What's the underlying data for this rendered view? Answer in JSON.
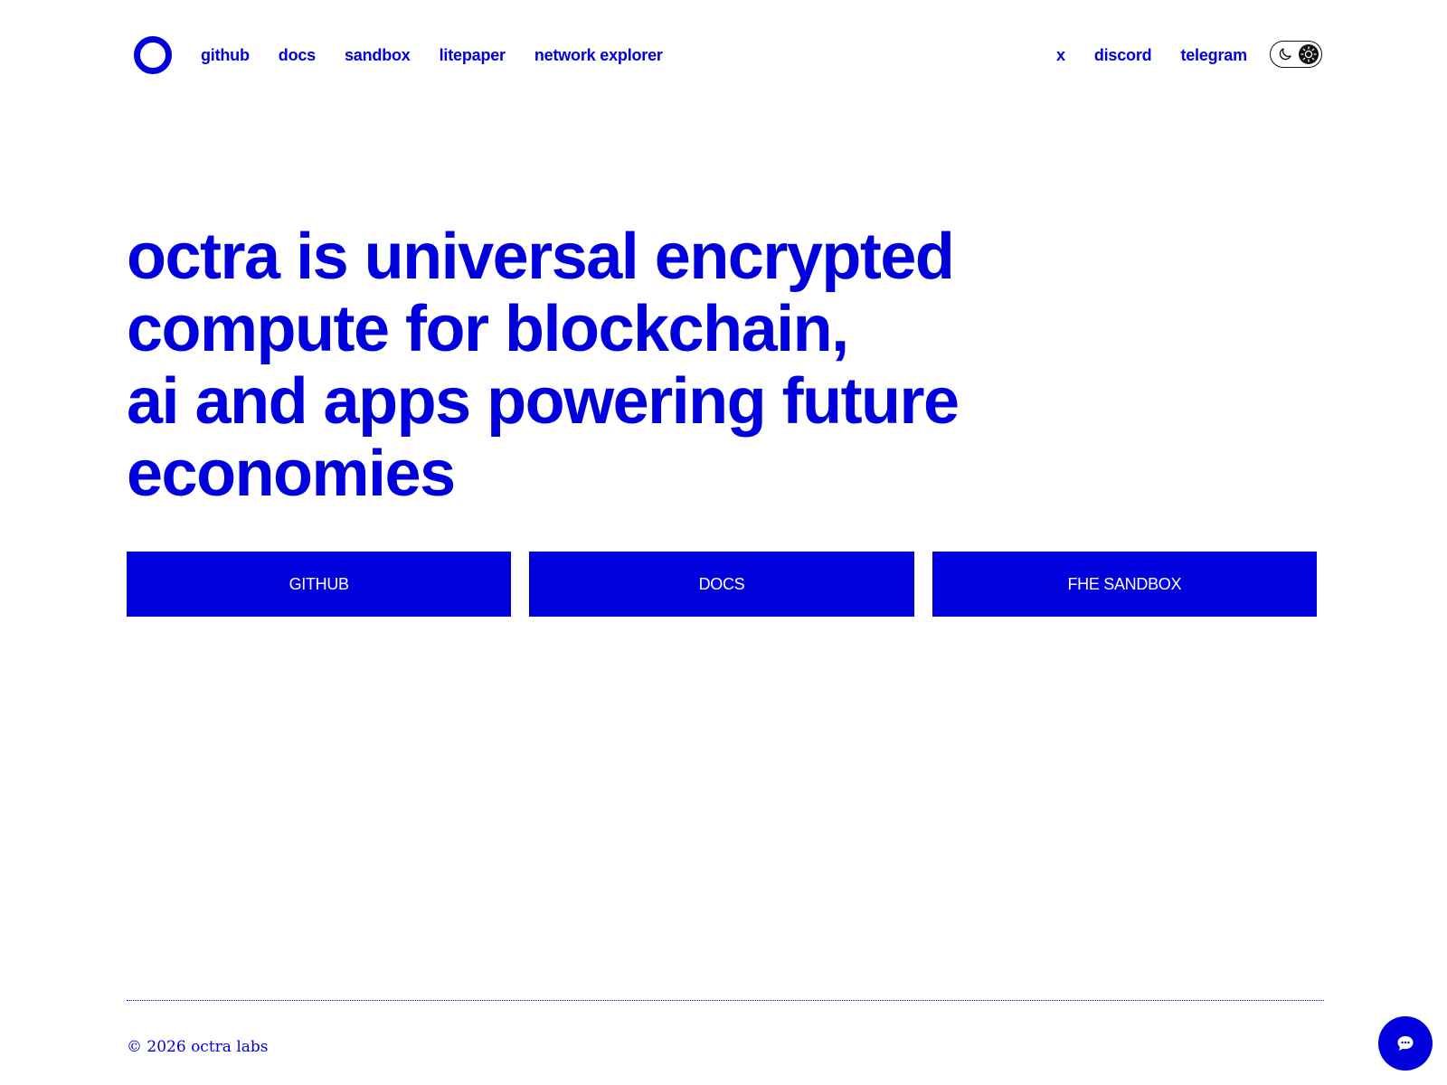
{
  "header": {
    "logo_icon": "ring-logo-icon",
    "nav_left": [
      {
        "label": "github"
      },
      {
        "label": "docs"
      },
      {
        "label": "sandbox"
      },
      {
        "label": "litepaper"
      },
      {
        "label": "network explorer"
      }
    ],
    "nav_right": [
      {
        "label": "x"
      },
      {
        "label": "discord"
      },
      {
        "label": "telegram"
      }
    ],
    "theme_toggle": {
      "icons": [
        "moon-icon",
        "sun-icon"
      ],
      "selected": "light"
    }
  },
  "hero": {
    "title_lines": [
      "octra is universal encrypted",
      "compute for blockchain,",
      "ai and apps powering future",
      "economies"
    ],
    "buttons": [
      {
        "label": "GITHUB"
      },
      {
        "label": "DOCS"
      },
      {
        "label": "FHE SANDBOX"
      }
    ]
  },
  "footer": {
    "copyright": "© 2026 octra labs"
  },
  "chat": {
    "icon": "chat-bubble-icon"
  },
  "colors": {
    "accent": "#0000dd",
    "background": "#ffffff",
    "button_text": "#ffffff",
    "toggle_dark": "#111111"
  }
}
